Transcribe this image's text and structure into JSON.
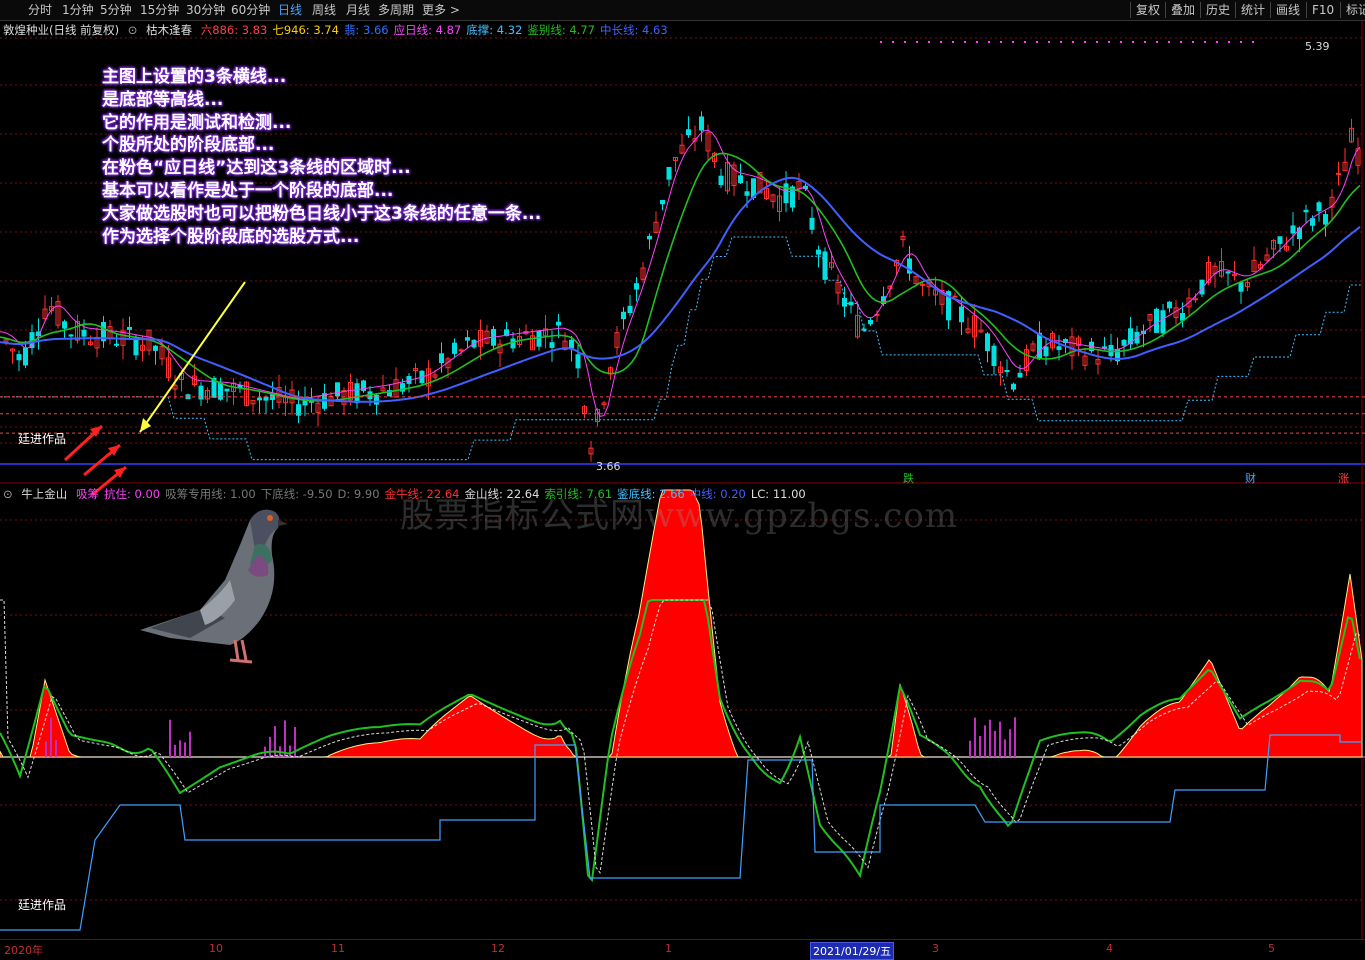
{
  "toolbar": {
    "periods": [
      "分时",
      "1分钟",
      "5分钟",
      "15分钟",
      "30分钟",
      "60分钟",
      "日线",
      "周线",
      "月线",
      "多周期",
      "更多 >"
    ],
    "active_period": "日线",
    "right_buttons": [
      "复权",
      "叠加",
      "历史",
      "统计",
      "画线",
      "F10",
      "标记"
    ]
  },
  "main_chart": {
    "title": "敦煌种业(日线 前复权)",
    "indicator_name": "枯木逢春",
    "values": [
      {
        "label": "六886: 3.83",
        "color": "#ff4040"
      },
      {
        "label": "七946: 3.74",
        "color": "#ffcc00"
      },
      {
        "label": "翡: 3.66",
        "color": "#3070ff"
      },
      {
        "label": "应日线: 4.87",
        "color": "#ff40ff"
      },
      {
        "label": "底撑: 4.32",
        "color": "#40c0ff"
      },
      {
        "label": "鉴别线: 4.77",
        "color": "#20c020"
      },
      {
        "label": "中长线: 4.63",
        "color": "#4060ff"
      }
    ],
    "high_label": "5.39",
    "low_label": "3.66",
    "annotation": [
      "主图上设置的3条横线...",
      "是底部等高线...",
      "它的作用是测试和检测...",
      "个股所处的阶段底部...",
      "在粉色“应日线”达到这3条线的区域时...",
      "基本可以看作是处于一个阶段的底部...",
      "大家做选股时也可以把粉色日线小于这3条线的任意一条...",
      "作为选择个股阶段底的选股方式..."
    ],
    "author_label": "廷进作品",
    "markers": [
      {
        "text": "跌",
        "color": "#20c020"
      },
      {
        "text": "财",
        "color": "#4aa3ff"
      },
      {
        "text": "涨",
        "color": "#ff4040"
      }
    ]
  },
  "sub_chart": {
    "indicator_name": "牛上金山",
    "values": [
      {
        "label": "吸筹",
        "color": "#ff40ff"
      },
      {
        "label": "抗住: 0.00",
        "color": "#ff40ff"
      },
      {
        "label": "吸筹专用线: 1.00",
        "color": "#777777"
      },
      {
        "label": "下底线: -9.50",
        "color": "#777777"
      },
      {
        "label": "D: 9.90",
        "color": "#777777"
      },
      {
        "label": "金牛线: 22.64",
        "color": "#ff3030"
      },
      {
        "label": "金山线: 22.64",
        "color": "#dddddd"
      },
      {
        "label": "索引线: 7.61",
        "color": "#20c020"
      },
      {
        "label": "鉴底线: 2.66",
        "color": "#40c0ff"
      },
      {
        "label": "中线: 0.20",
        "color": "#4060ff"
      },
      {
        "label": "LC: 11.00",
        "color": "#dddddd"
      }
    ],
    "watermark": "股票指标公式网www.gpzbgs.com",
    "author_label": "廷进作品"
  },
  "time_axis": {
    "ticks": [
      "2020年",
      "10",
      "11",
      "12",
      "1",
      "2021/01/29/五",
      "3",
      "4",
      "5"
    ],
    "selected": "2021/01/29/五"
  },
  "chart_data": {
    "type": "line",
    "title": "敦煌种业(日线 前复权)",
    "price_range": [
      3.66,
      5.39
    ],
    "series": [
      {
        "name": "应日线",
        "color": "#ff40ff",
        "last": 4.87
      },
      {
        "name": "底撑",
        "color": "#40c0ff",
        "last": 4.32
      },
      {
        "name": "鉴别线",
        "color": "#20c020",
        "last": 4.77
      },
      {
        "name": "中长线",
        "color": "#4060ff",
        "last": 4.63
      }
    ],
    "sub_series": [
      {
        "name": "金牛线",
        "color": "#ff3030",
        "last": 22.64
      },
      {
        "name": "金山线",
        "color": "#dddddd",
        "last": 22.64
      },
      {
        "name": "索引线",
        "color": "#20c020",
        "last": 7.61
      },
      {
        "name": "鉴底线",
        "color": "#40c0ff",
        "last": 2.66
      },
      {
        "name": "中线",
        "color": "#4060ff",
        "last": 0.2
      }
    ],
    "grid": true
  }
}
